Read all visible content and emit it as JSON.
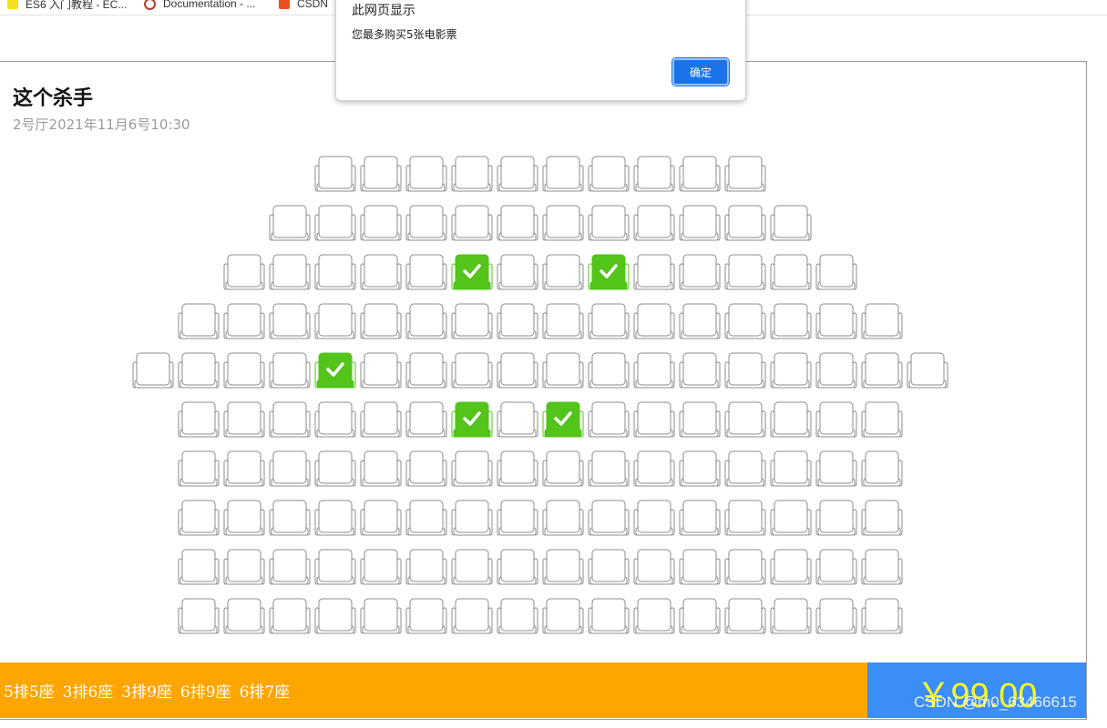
{
  "bookmarks": [
    {
      "label": "ES6 入门教程 - EC..."
    },
    {
      "label": "Documentation - ..."
    },
    {
      "label": "CSDN"
    }
  ],
  "movie": {
    "title": "这个杀手",
    "info": "2号厅2021年11月6号10:30"
  },
  "seat_rows": [
    {
      "row": 1,
      "seat_count": 10,
      "sold": []
    },
    {
      "row": 2,
      "seat_count": 12,
      "sold": []
    },
    {
      "row": 3,
      "seat_count": 14,
      "sold": [
        6,
        9
      ]
    },
    {
      "row": 4,
      "seat_count": 16,
      "sold": []
    },
    {
      "row": 5,
      "seat_count": 18,
      "sold": [
        5
      ]
    },
    {
      "row": 6,
      "seat_count": 16,
      "sold": [
        7,
        9
      ]
    },
    {
      "row": 7,
      "seat_count": 16,
      "sold": []
    },
    {
      "row": 8,
      "seat_count": 16,
      "sold": []
    },
    {
      "row": 9,
      "seat_count": 16,
      "sold": []
    },
    {
      "row": 10,
      "seat_count": 16,
      "sold": []
    }
  ],
  "selected_seats": [
    "5排5座",
    "3排6座",
    "3排9座",
    "6排9座",
    "6排7座"
  ],
  "price": "￥99.00",
  "watermark": "CSDN @m0_63466615",
  "dialog": {
    "title": "此网页显示",
    "message": "您最多购买5张电影票",
    "ok_label": "确定"
  },
  "colors": {
    "selected_seat": "#52c41a",
    "bottom_bar": "#ffa500",
    "price_box": "#3a8ef6",
    "price_text": "#f6f62a",
    "dialog_button": "#1a73e8"
  }
}
